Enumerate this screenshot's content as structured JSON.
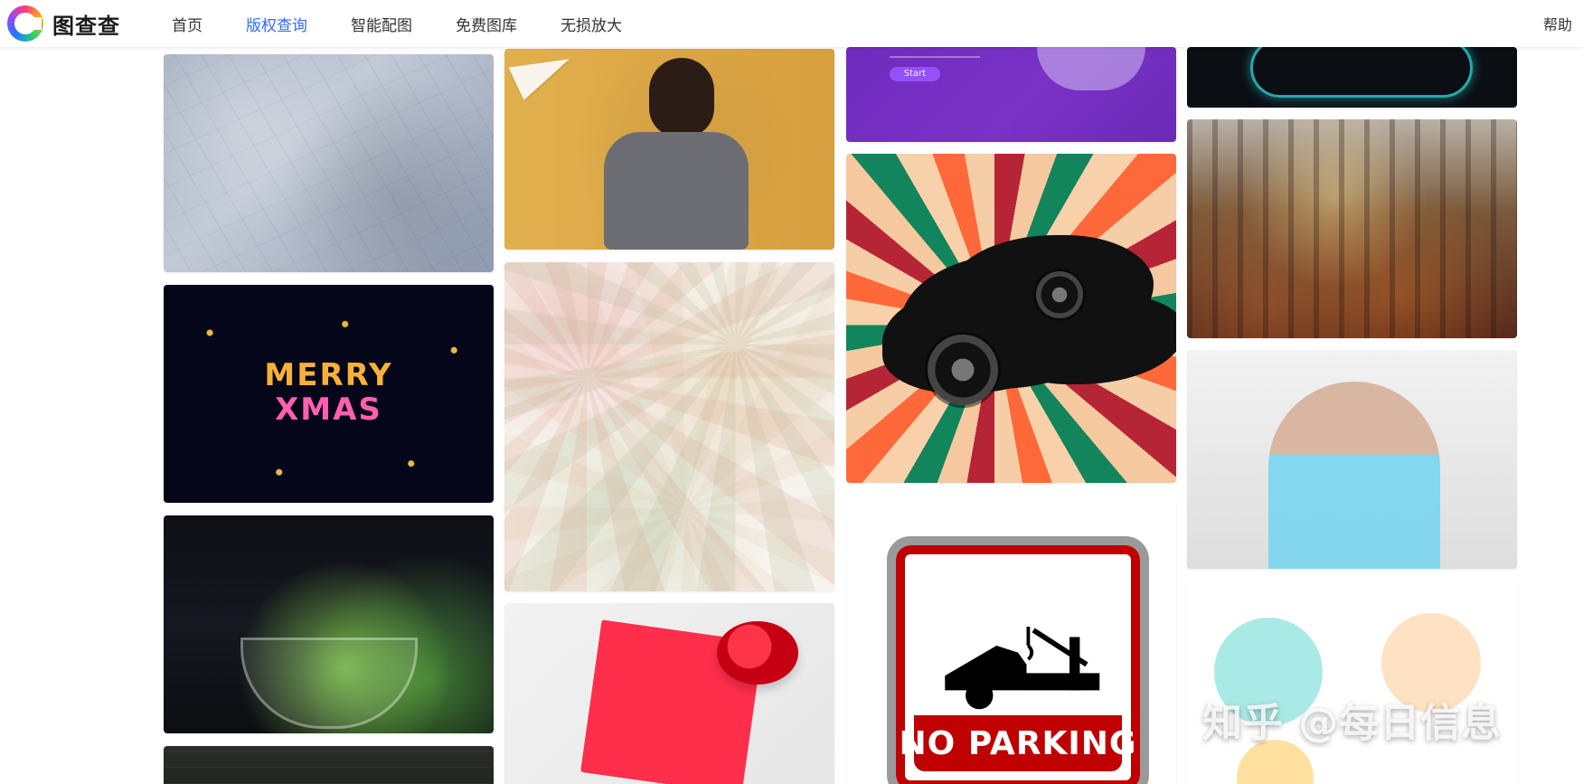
{
  "header": {
    "brand": "图查查",
    "nav": [
      {
        "label": "首页",
        "active": false
      },
      {
        "label": "版权查询",
        "active": true
      },
      {
        "label": "智能配图",
        "active": false
      },
      {
        "label": "免费图库",
        "active": false
      },
      {
        "label": "无损放大",
        "active": false
      }
    ],
    "help_label": "帮助",
    "accent_color": "#2f6bff"
  },
  "gallery": {
    "tiles": [
      {
        "name": "image-cracked-wall",
        "caption": ""
      },
      {
        "name": "image-boy-with-paper-plane",
        "caption": ""
      },
      {
        "name": "image-purple-web-banner",
        "caption": "",
        "button_text": "Start"
      },
      {
        "name": "image-neon-sign",
        "caption": ""
      },
      {
        "name": "image-autumn-forest",
        "caption": ""
      },
      {
        "name": "image-merry-xmas",
        "caption": "",
        "text_lines": [
          "MERRY",
          "XMAS"
        ]
      },
      {
        "name": "image-dried-palm-pattern",
        "caption": ""
      },
      {
        "name": "image-speakers-sunburst",
        "caption": ""
      },
      {
        "name": "image-woman-with-headphones",
        "caption": ""
      },
      {
        "name": "image-salad-bowl",
        "caption": ""
      },
      {
        "name": "image-heart-and-rose",
        "caption": ""
      },
      {
        "name": "image-no-parking-sign",
        "caption": "",
        "sign_text": "NO PARKING"
      },
      {
        "name": "image-christmas-stickers",
        "caption": ""
      },
      {
        "name": "image-chalkboard",
        "caption": ""
      }
    ]
  },
  "overlay": {
    "watermark_text": "知乎 @每日信息"
  }
}
